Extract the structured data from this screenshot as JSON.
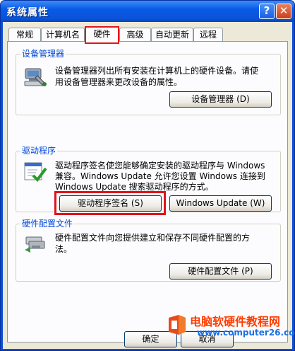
{
  "window": {
    "title": "系统属性",
    "help_glyph": "?",
    "close_glyph": "✕"
  },
  "tabs": [
    {
      "label": "常规"
    },
    {
      "label": "计算机名"
    },
    {
      "label": "硬件"
    },
    {
      "label": "高级"
    },
    {
      "label": "自动更新"
    },
    {
      "label": "远程"
    }
  ],
  "active_tab": "硬件",
  "device_manager": {
    "title": "设备管理器",
    "line1": "设备管理器列出所有安装在计算机上的硬件设备。请使",
    "line2": "用设备管理器来更改设备的属性。",
    "button": "设备管理器 (D)"
  },
  "drivers": {
    "title": "驱动程序",
    "line1": "驱动程序签名使您能够确定安装的驱动程序与 Windows",
    "line2": "兼容。Windows Update 允许您设置 Windows 连接到",
    "line3": "Windows Update 搜索驱动程序的方式。",
    "sign_button": "驱动程序签名 (S)",
    "update_button": "Windows Update (W)"
  },
  "profiles": {
    "title": "硬件配置文件",
    "line1": "硬件配置文件向您提供建立和保存不同硬件配置的方",
    "line2": "法。",
    "button": "硬件配置文件 (P)"
  },
  "footer": {
    "ok": "确定",
    "cancel": "取消"
  },
  "watermark": {
    "title": "电脑软硬件教程网",
    "url": "www.computer26.com"
  },
  "colors": {
    "titlebar": "#0a52d8",
    "group_title": "#0046d5",
    "highlight": "#e0141a",
    "dialog_bg": "#ece9d8"
  }
}
